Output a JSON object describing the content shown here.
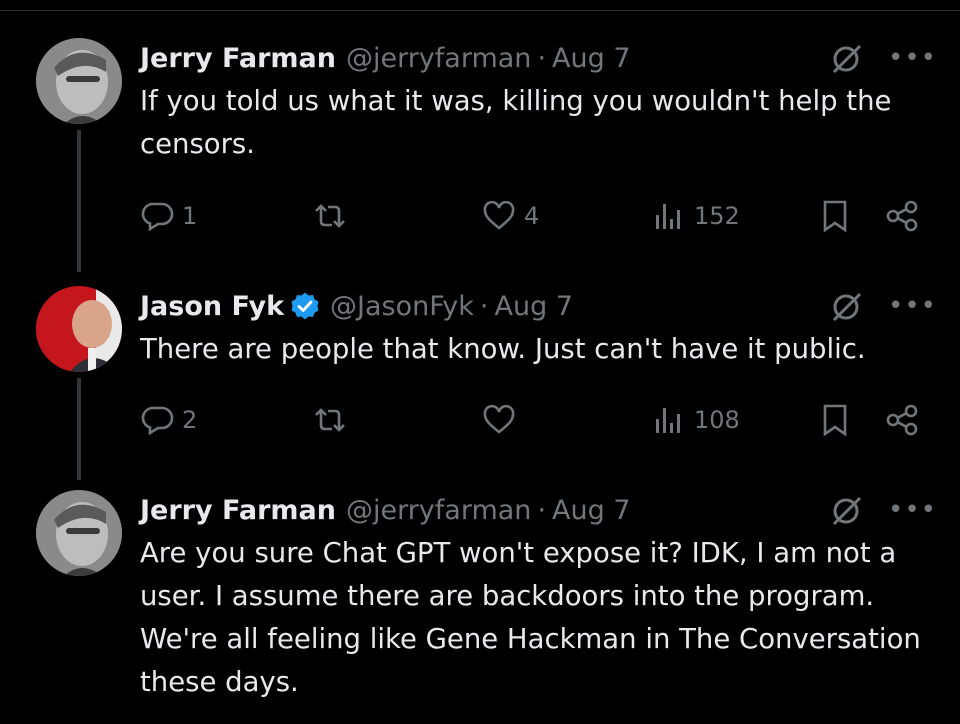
{
  "tweets": [
    {
      "name": "Jerry Farman",
      "handle": "@jerryfarman",
      "separator": "·",
      "date": "Aug 7",
      "verified": false,
      "text": "If you told us what it was, killing you wouldn't help the censors.",
      "replies": "1",
      "retweets": "",
      "likes": "4",
      "views": "152"
    },
    {
      "name": "Jason Fyk",
      "handle": "@JasonFyk",
      "separator": "·",
      "date": "Aug 7",
      "verified": true,
      "text": "There are people that know. Just can't have it public.",
      "replies": "2",
      "retweets": "",
      "likes": "",
      "views": "108"
    },
    {
      "name": "Jerry Farman",
      "handle": "@jerryfarman",
      "separator": "·",
      "date": "Aug 7",
      "verified": false,
      "text": "Are you sure Chat GPT won't expose it? IDK, I am not a user. I assume there are backdoors into the program. We're all feeling like Gene Hackman in The Conversation these days."
    }
  ],
  "icons": {
    "reply": "reply-icon",
    "retweet": "retweet-icon",
    "like": "heart-icon",
    "views": "views-icon",
    "bookmark": "bookmark-icon",
    "share": "share-icon",
    "grok": "grok-icon",
    "more": "more-icon",
    "verified": "verified-badge-icon"
  },
  "colors": {
    "background": "#000000",
    "text": "#e7e9ea",
    "muted": "#71767b",
    "verified": "#1d9bf0",
    "divider": "#2f3336"
  }
}
